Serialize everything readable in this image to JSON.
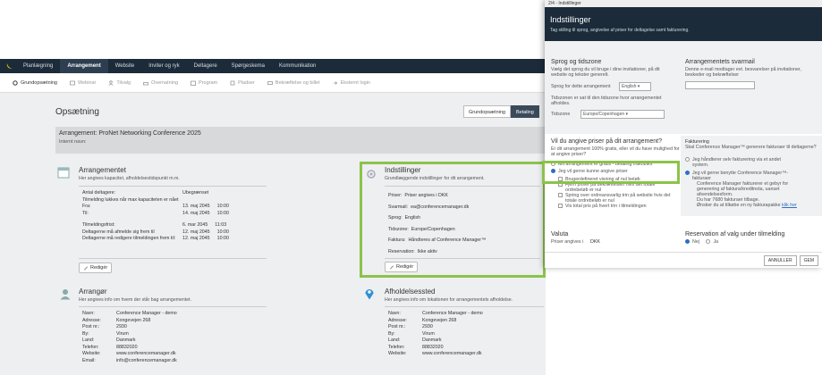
{
  "modal": {
    "topbar": "2/4 - Indstillinger",
    "title": "Indstillinger",
    "subtitle": "Tag stilling til sprog, angivelse af priser for deltagelse samt fakturering.",
    "language": {
      "heading": "Sprog og tidszone",
      "desc": "Vælg det sprog du vil bruge i dine invitationer, på dit website og tekster generelt.",
      "lang_label": "Sprog for dette arrangement",
      "lang_value": "English",
      "tz_desc": "Tidszonen er sat til den tidszone hvor arrangementet afholdes.",
      "tz_label": "Tidszone",
      "tz_value": "Europe/Copenhagen"
    },
    "reply": {
      "heading": "Arrangementets svarmail",
      "desc": "Denne e-mail modtager evt. besvarelser på invitationer, beskeder og bekræftelser"
    },
    "prices": {
      "heading": "Vil du angive priser på dit arrangement?",
      "desc": "Er dit arrangement 100% gratis, eller vil du have mulighed for at angive priser?",
      "opt_free": "Mit arrangement er gratis - betaling frakobles",
      "opt_prices": "Jeg vil gerne kunne angive priser",
      "checks": [
        "Brugerdefineret visning af nul beløb",
        "Fjern priser på bekræftelsen hvis det totale ordrebeløb er nul",
        "Spring over ordreansvarlig trin på website hvis det totale ordrebeløb er nul",
        "Vis total pris på hvert trin i tilmeldingen"
      ]
    },
    "billing": {
      "heading": "Fakturering",
      "desc": "Skal Conference Manager™ generere fakturaer til deltagerne?",
      "opt_self": "Jeg håndterer selv fakturering via et andet system.",
      "opt_cm": "Jeg vil gerne benytte Conference Manager™-fakturaer",
      "cm_desc": "Conference Manager fakturerer et gebyr for generering af faktura/kreditnota, uanset afsendelsesform.",
      "fee": "Du har 7680 fakturaer tilbage.",
      "more": "Ønsker du at tilkøbe en ny fakturapakke",
      "link": "klik her"
    },
    "currency": {
      "heading": "Valuta",
      "label": "Priser angives i",
      "value": "DKK"
    },
    "reservation": {
      "heading": "Reservation af valg under tilmelding",
      "opt_no": "Nej",
      "opt_yes": "Ja"
    },
    "cancel": "ANNULLER",
    "save": "GEM"
  },
  "topnav": [
    "Planlægning",
    "Arrangement",
    "Website",
    "Inviter og ryk",
    "Deltagere",
    "Spørgeskema",
    "Kommunikation"
  ],
  "subnav": [
    "Grundopsætning",
    "Webinar",
    "Tilvalg",
    "Overnatning",
    "Program",
    "Pladser",
    "Bekræftelse og billet",
    "Eksternt login"
  ],
  "page": {
    "title": "Opsætning",
    "tabs": [
      "Grundopsætning",
      "Betaling"
    ],
    "event_title": "Arrangement: ProNet Networking Conference 2025",
    "event_sub": "Internt navn:"
  },
  "arrangementet": {
    "title": "Arrangementet",
    "desc": "Her angives kapacitet, afholdelsestidspunkt m.m.",
    "cap_label": "Antal deltagere:",
    "cap_value": "Ubegrænset",
    "cap_note": "Tilmelding lukkes når max kapaciteten er nået",
    "from_label": "Fra:",
    "from_date": "13. maj 2045",
    "from_time": "10:00",
    "to_label": "Til:",
    "to_date": "14. maj 2045",
    "to_time": "10:00",
    "deadline_label": "Tilmeldingsfrist:",
    "deadline_date": "6. mar 2045",
    "deadline_time": "11:03",
    "unreg_label": "Deltagerne må afmelde sig frem til",
    "unreg_date": "12. maj 2045",
    "unreg_time": "10:00",
    "edit_label": "Deltagerne må redigere tilmeldingen frem til:",
    "edit_date": "12. maj 2045",
    "edit_time": "10:00",
    "button": "Redigér"
  },
  "indstillinger": {
    "title": "Indstillinger",
    "desc": "Grundlæggende indstillinger for dit arrangement.",
    "rows": [
      {
        "k": "Priser:",
        "v": "Priser angives i DKK"
      },
      {
        "k": "Svarmail:",
        "v": "ea@conferencemanager.dk"
      },
      {
        "k": "Sprog:",
        "v": "English"
      },
      {
        "k": "Tidszone:",
        "v": "Europe/Copenhagen"
      },
      {
        "k": "Faktura:",
        "v": "Håndteres af Conference Manager™"
      },
      {
        "k": "Reservation:",
        "v": "Ikke aktiv"
      }
    ],
    "button": "Redigér"
  },
  "arrangoer": {
    "title": "Arrangør",
    "desc": "Her angives info om hvem der står bag arrangementet.",
    "rows": [
      {
        "k": "Navn:",
        "v": "Conference Manager - demo"
      },
      {
        "k": "Adresse:",
        "v": "Kongevejen 268"
      },
      {
        "k": "Post nr.:",
        "v": "2930"
      },
      {
        "k": "By:",
        "v": "Virum"
      },
      {
        "k": "Land:",
        "v": "Danmark"
      },
      {
        "k": "Telefon:",
        "v": "88832020"
      },
      {
        "k": "Website:",
        "v": "www.conferencemanager.dk"
      },
      {
        "k": "Email:",
        "v": "info@conferencemanager.dk"
      }
    ]
  },
  "afholdelsessted": {
    "title": "Afholdelsessted",
    "desc": "Her angives info om lokationen for arrangementets afholdelse.",
    "rows": [
      {
        "k": "Navn:",
        "v": "Conference Manager - demo"
      },
      {
        "k": "Adresse:",
        "v": "Kongevejen 268"
      },
      {
        "k": "Post nr.:",
        "v": "2930"
      },
      {
        "k": "By:",
        "v": "Virum"
      },
      {
        "k": "Land:",
        "v": "Danmark"
      },
      {
        "k": "Telefon:",
        "v": "88832020"
      },
      {
        "k": "Website:",
        "v": "www.conferencemanager.dk"
      }
    ]
  },
  "colors": {
    "nav": "#1c2b3a",
    "highlight": "#8bc34a",
    "accent": "#2d6fc2"
  }
}
